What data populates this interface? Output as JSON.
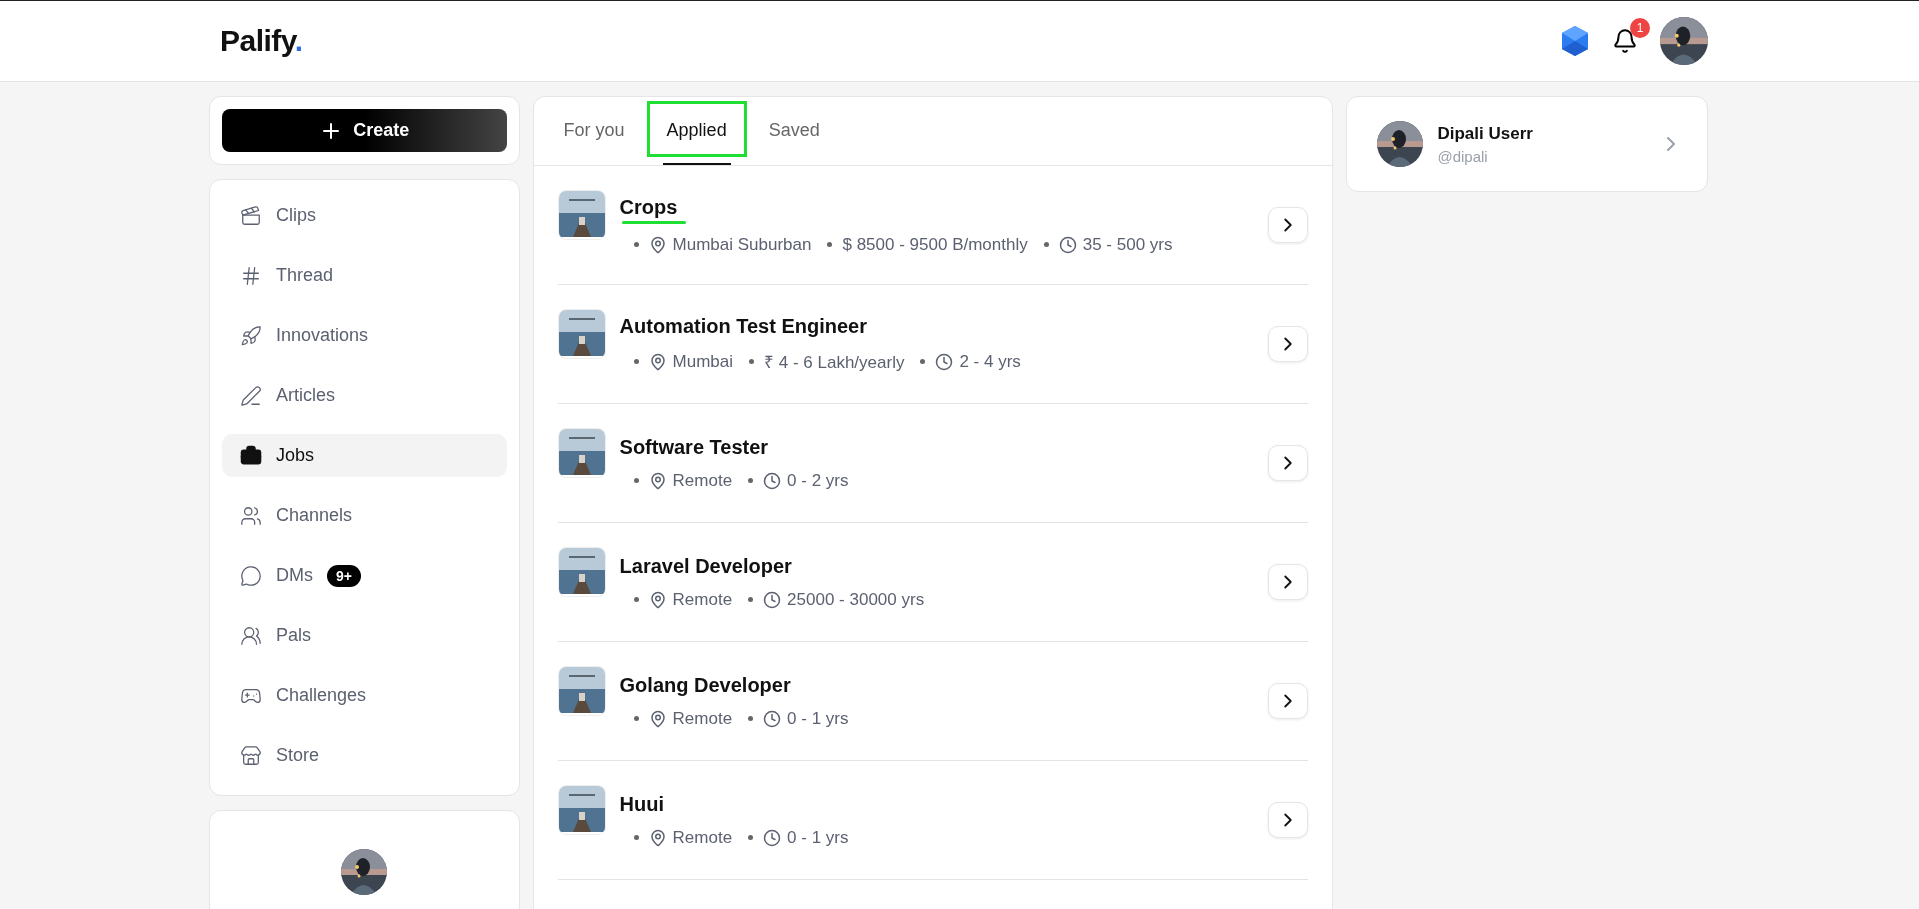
{
  "header": {
    "logo": {
      "text": "Palify",
      "mark": "."
    },
    "notifications": "1"
  },
  "sidebar": {
    "create": "Create",
    "items": [
      {
        "label": "Clips",
        "selected": false
      },
      {
        "label": "Thread",
        "selected": false
      },
      {
        "label": "Innovations",
        "selected": false
      },
      {
        "label": "Articles",
        "selected": false
      },
      {
        "label": "Jobs",
        "selected": true
      },
      {
        "label": "Channels",
        "selected": false
      },
      {
        "label": "DMs",
        "selected": false,
        "badge": "9+"
      },
      {
        "label": "Pals",
        "selected": false
      },
      {
        "label": "Challenges",
        "selected": false
      },
      {
        "label": "Store",
        "selected": false
      }
    ]
  },
  "tabs": [
    {
      "label": "For you",
      "selected": false,
      "highlighted": false
    },
    {
      "label": "Applied",
      "selected": true,
      "highlighted": true
    },
    {
      "label": "Saved",
      "selected": false,
      "highlighted": false
    }
  ],
  "jobs": [
    {
      "title": "Crops",
      "underlined": true,
      "meta": [
        {
          "kind": "location",
          "text": "Mumbai Suburban"
        },
        {
          "kind": "salary",
          "text": "$ 8500 - 9500 B/monthly"
        },
        {
          "kind": "experience",
          "text": "35 - 500 yrs"
        }
      ]
    },
    {
      "title": "Automation Test Engineer",
      "underlined": false,
      "meta": [
        {
          "kind": "location",
          "text": "Mumbai"
        },
        {
          "kind": "salary",
          "text": "₹ 4 - 6 Lakh/yearly"
        },
        {
          "kind": "experience",
          "text": "2 - 4 yrs"
        }
      ]
    },
    {
      "title": "Software Tester",
      "underlined": false,
      "meta": [
        {
          "kind": "location",
          "text": "Remote"
        },
        {
          "kind": "experience",
          "text": "0 - 2 yrs"
        }
      ]
    },
    {
      "title": "Laravel Developer",
      "underlined": false,
      "meta": [
        {
          "kind": "location",
          "text": "Remote"
        },
        {
          "kind": "experience",
          "text": "25000 - 30000 yrs"
        }
      ]
    },
    {
      "title": "Golang Developer",
      "underlined": false,
      "meta": [
        {
          "kind": "location",
          "text": "Remote"
        },
        {
          "kind": "experience",
          "text": "0 - 1 yrs"
        }
      ]
    },
    {
      "title": "Huui",
      "underlined": false,
      "meta": [
        {
          "kind": "location",
          "text": "Remote"
        },
        {
          "kind": "experience",
          "text": "0 - 1 yrs"
        }
      ]
    }
  ],
  "profile": {
    "name": "Dipali Userr",
    "handle": "@dipali"
  }
}
